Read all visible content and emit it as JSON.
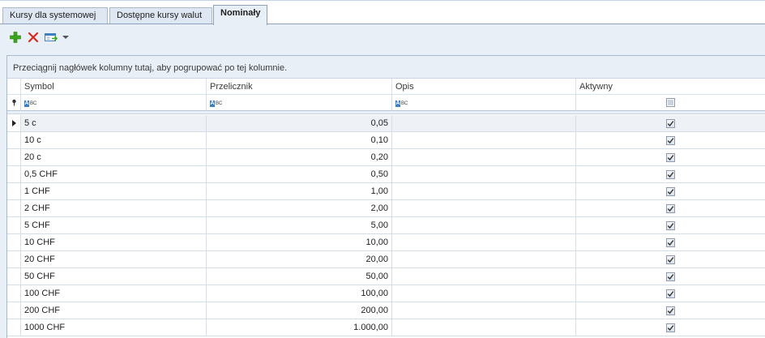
{
  "tabs": [
    {
      "label": "Kursy dla systemowej"
    },
    {
      "label": "Dostępne kursy walut"
    },
    {
      "label": "Nominały"
    }
  ],
  "toolbar": {
    "icons": [
      "add-icon",
      "delete-icon",
      "export-icon",
      "chevron-down-icon"
    ],
    "colors": {
      "add": "#3aa81e",
      "delete": "#d9291c"
    }
  },
  "grid": {
    "group_hint": "Przeciągnij nagłówek kolumny tutaj, aby pogrupować po tej kolumnie.",
    "columns": [
      "Symbol",
      "Przelicznik",
      "Opis",
      "Aktywny"
    ],
    "filter": {
      "aktywny_checked": false
    },
    "rows": [
      {
        "symbol": "5 c",
        "przelicznik": "0,05",
        "opis": "",
        "aktywny": true
      },
      {
        "symbol": "10 c",
        "przelicznik": "0,10",
        "opis": "",
        "aktywny": true
      },
      {
        "symbol": "20 c",
        "przelicznik": "0,20",
        "opis": "",
        "aktywny": true
      },
      {
        "symbol": "0,5 CHF",
        "przelicznik": "0,50",
        "opis": "",
        "aktywny": true
      },
      {
        "symbol": "1 CHF",
        "przelicznik": "1,00",
        "opis": "",
        "aktywny": true
      },
      {
        "symbol": "2 CHF",
        "przelicznik": "2,00",
        "opis": "",
        "aktywny": true
      },
      {
        "symbol": "5 CHF",
        "przelicznik": "5,00",
        "opis": "",
        "aktywny": true
      },
      {
        "symbol": "10 CHF",
        "przelicznik": "10,00",
        "opis": "",
        "aktywny": true
      },
      {
        "symbol": "20 CHF",
        "przelicznik": "20,00",
        "opis": "",
        "aktywny": true
      },
      {
        "symbol": "50 CHF",
        "przelicznik": "50,00",
        "opis": "",
        "aktywny": true
      },
      {
        "symbol": "100 CHF",
        "przelicznik": "100,00",
        "opis": "",
        "aktywny": true
      },
      {
        "symbol": "200 CHF",
        "przelicznik": "200,00",
        "opis": "",
        "aktywny": true
      },
      {
        "symbol": "1000 CHF",
        "przelicznik": "1.000,00",
        "opis": "",
        "aktywny": true
      }
    ]
  }
}
